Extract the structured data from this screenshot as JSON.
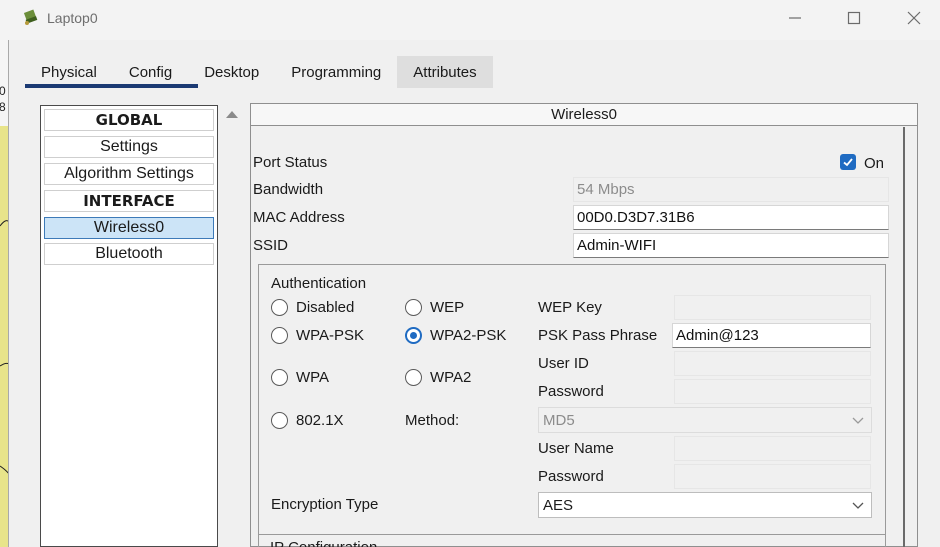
{
  "window": {
    "title": "Laptop0",
    "icon": "laptop-app-icon"
  },
  "left_strip": {
    "glyphs": [
      "0",
      "8"
    ]
  },
  "tabs": [
    {
      "label": "Physical",
      "active": false
    },
    {
      "label": "Config",
      "active": true
    },
    {
      "label": "Desktop",
      "active": false
    },
    {
      "label": "Programming",
      "active": false
    },
    {
      "label": "Attributes",
      "active": false
    }
  ],
  "sidebar": {
    "items": [
      {
        "label": "GLOBAL",
        "heading": true
      },
      {
        "label": "Settings"
      },
      {
        "label": "Algorithm Settings"
      },
      {
        "label": "INTERFACE",
        "heading": true
      },
      {
        "label": "Wireless0",
        "selected": true
      },
      {
        "label": "Bluetooth"
      }
    ]
  },
  "panel": {
    "title": "Wireless0",
    "port_status": {
      "label": "Port Status",
      "checked": true,
      "checkbox_label": "On"
    },
    "bandwidth": {
      "label": "Bandwidth",
      "value": "54 Mbps"
    },
    "mac": {
      "label": "MAC Address",
      "value": "00D0.D3D7.31B6"
    },
    "ssid": {
      "label": "SSID",
      "value": "Admin-WIFI"
    },
    "auth": {
      "title": "Authentication",
      "options": {
        "disabled": "Disabled",
        "wep": "WEP",
        "wpa_psk": "WPA-PSK",
        "wpa2_psk": "WPA2-PSK",
        "wpa": "WPA",
        "wpa2": "WPA2",
        "dot1x": "802.1X"
      },
      "selected": "WPA2-PSK",
      "method_label": "Method:",
      "method_value": "MD5",
      "wep_key_label": "WEP Key",
      "psk_label": "PSK Pass Phrase",
      "psk_value": "Admin@123",
      "user_id_label": "User ID",
      "password_label": "Password",
      "user_name_label": "User Name",
      "password2_label": "Password"
    },
    "encryption": {
      "label": "Encryption Type",
      "value": "AES"
    },
    "next_section": "IP Configuration"
  },
  "colors": {
    "accent": "#1f6bc2",
    "tab_underline": "#1b3a73",
    "selected_item": "#cce4f7"
  }
}
